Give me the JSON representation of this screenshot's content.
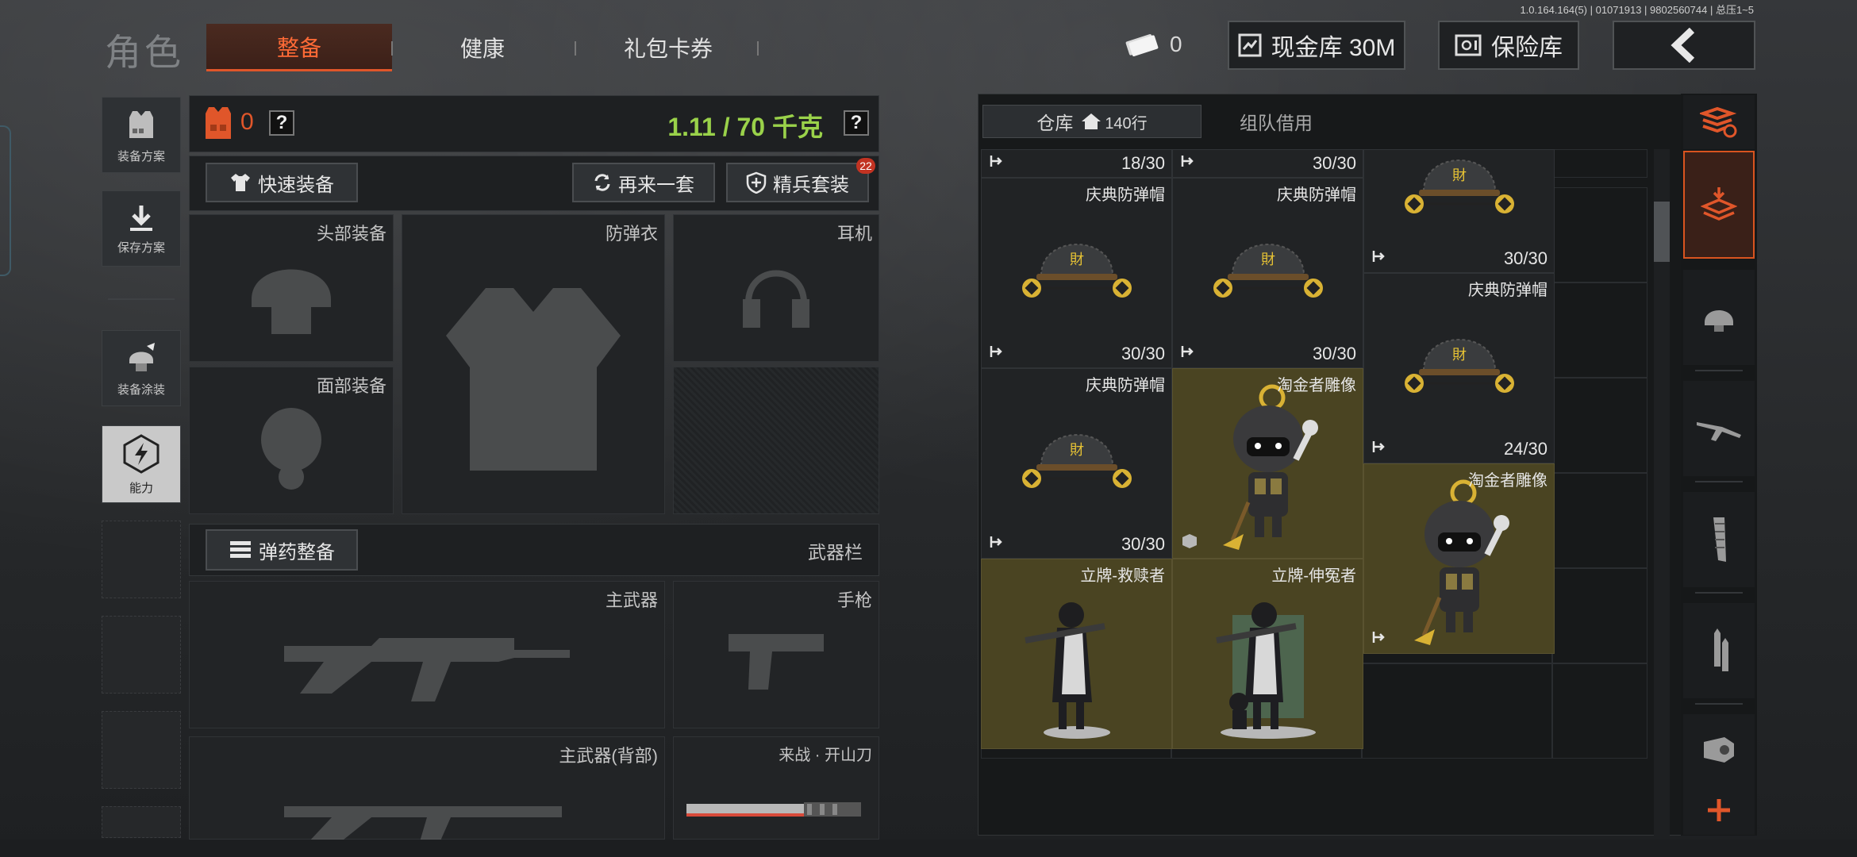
{
  "version": "1.0.164.164(5) | 01071913 | 9802560744 | 总压1~5",
  "header": {
    "title": "角色",
    "tabs": [
      {
        "label": "整备",
        "active": true
      },
      {
        "label": "健康",
        "active": false
      },
      {
        "label": "礼包卡券",
        "active": false
      }
    ],
    "cash_count": "0",
    "cash_vault_label": "现金库 30M",
    "safe_label": "保险库",
    "back_icon": "chevron-left-icon"
  },
  "left_rail": [
    {
      "label": "装备方案",
      "icon": "vest-icon"
    },
    {
      "label": "保存方案",
      "icon": "download-icon"
    },
    {
      "label": "装备涂装",
      "icon": "helmet-paint-icon"
    },
    {
      "label": "能力",
      "icon": "lightning-icon",
      "active": true
    }
  ],
  "loadout": {
    "armor_count": "0",
    "help": "?",
    "weight": "1.11 / 70 千克",
    "quick_equip": "快速装备",
    "redo_set": "再来一套",
    "elite_set": "精兵套装",
    "elite_badge": "22",
    "slots": {
      "head": "头部装备",
      "vest": "防弹衣",
      "earphone": "耳机",
      "face": "面部装备"
    },
    "ammo_button": "弹药整备",
    "weapon_bar": "武器栏",
    "primary": "主武器",
    "pistol": "手枪",
    "primary_back": "主武器(背部)",
    "melee": "来战 · 开山刀"
  },
  "storage": {
    "tab_warehouse": "仓库",
    "rows": "140行",
    "tab_team": "组队借用",
    "items": [
      {
        "name": "",
        "count": "18/30",
        "col": 0,
        "row": 0,
        "gold": false,
        "type": "partial"
      },
      {
        "name": "",
        "count": "30/30",
        "col": 1,
        "row": 0,
        "gold": false,
        "type": "partial"
      },
      {
        "name": "庆典防弹帽",
        "count": "30/30",
        "col": 0,
        "row": 1,
        "gold": false,
        "type": "helmet"
      },
      {
        "name": "庆典防弹帽",
        "count": "30/30",
        "col": 1,
        "row": 1,
        "gold": false,
        "type": "helmet"
      },
      {
        "name": "",
        "count": "30/30",
        "col": 2,
        "row": 0,
        "gold": false,
        "type": "helmet-top"
      },
      {
        "name": "庆典防弹帽",
        "count": "24/30",
        "col": 2,
        "row": 2,
        "gold": false,
        "type": "helmet"
      },
      {
        "name": "庆典防弹帽",
        "count": "30/30",
        "col": 0,
        "row": 3,
        "gold": false,
        "type": "helmet"
      },
      {
        "name": "淘金者雕像",
        "count": "",
        "col": 1,
        "row": 3,
        "gold": true,
        "type": "statue"
      },
      {
        "name": "淘金者雕像",
        "count": "",
        "col": 2,
        "row": 4,
        "gold": true,
        "type": "statue"
      },
      {
        "name": "立牌-救赎者",
        "count": "",
        "col": 0,
        "row": 5,
        "gold": true,
        "type": "standee"
      },
      {
        "name": "立牌-伸冤者",
        "count": "",
        "col": 1,
        "row": 5,
        "gold": true,
        "type": "standee"
      }
    ]
  },
  "side_filters": [
    "stack-refresh-icon",
    "layer-download-icon",
    "helmet-icon",
    "rifle-icon",
    "magazine-icon",
    "bullet-icon",
    "scope-icon",
    "plus-icon"
  ],
  "colors": {
    "accent": "#e0562a",
    "weight": "#9ad24a",
    "gold_cell": "#4a4422"
  }
}
